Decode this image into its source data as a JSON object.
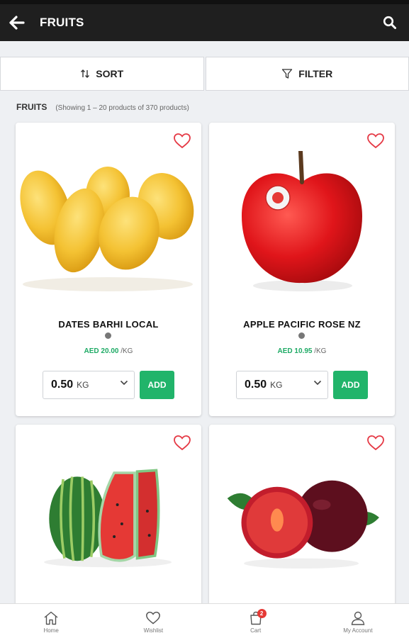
{
  "header": {
    "title": "FRUITS",
    "back_icon": "arrow-left-icon",
    "search_icon": "search-icon"
  },
  "toolbar": {
    "sort_label": "SORT",
    "filter_label": "FILTER"
  },
  "listing": {
    "heading": "FRUITS",
    "count_text": "(Showing 1 – 20 products of 370 products)"
  },
  "products": [
    {
      "name": "DATES BARHI LOCAL",
      "price": "AED 20.00",
      "unit": "/KG",
      "qty": "0.50",
      "qty_unit": "KG",
      "add_label": "ADD",
      "image": "mango-image"
    },
    {
      "name": "APPLE PACIFIC ROSE NZ",
      "price": "AED 10.95",
      "unit": "/KG",
      "qty": "0.50",
      "qty_unit": "KG",
      "add_label": "ADD",
      "image": "apple-image"
    },
    {
      "name": "",
      "image": "watermelon-image"
    },
    {
      "name": "",
      "image": "plum-image"
    }
  ],
  "nav": {
    "home": "Home",
    "wishlist": "Wishlist",
    "cart": "Cart",
    "cart_count": "2",
    "account": "My Account"
  },
  "colors": {
    "accent": "#21b46a",
    "price": "#1eaa65",
    "heart": "#e53945",
    "appbar": "#1f1f1f",
    "badge": "#e53935"
  }
}
